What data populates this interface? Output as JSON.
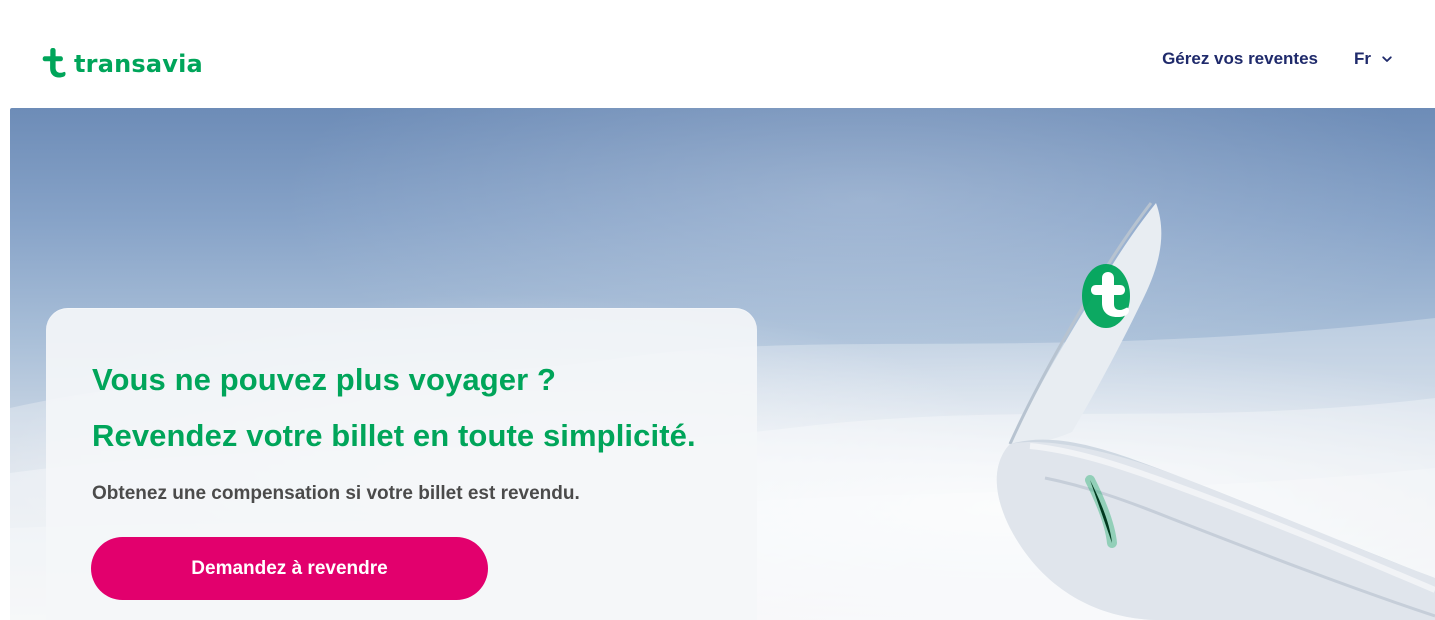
{
  "brand": {
    "name": "transavia",
    "accent_green": "#00A55A",
    "accent_pink": "#E2006D",
    "nav_text_color": "#1F2A6B"
  },
  "header": {
    "logo_icon": "transavia-t-logo-icon",
    "nav": {
      "manage_resales_label": "Gérez vos reventes",
      "language_label": "Fr",
      "language_chevron_icon": "chevron-down-icon"
    }
  },
  "hero": {
    "image_description_icon": "airplane-wing-icon",
    "card": {
      "title_line_1": "Vous ne pouvez plus voyager ?",
      "title_line_2": "Revendez votre billet en toute simplicité.",
      "subtitle": "Obtenez une compensation si votre billet est revendu.",
      "cta_label": "Demandez à revendre"
    }
  }
}
